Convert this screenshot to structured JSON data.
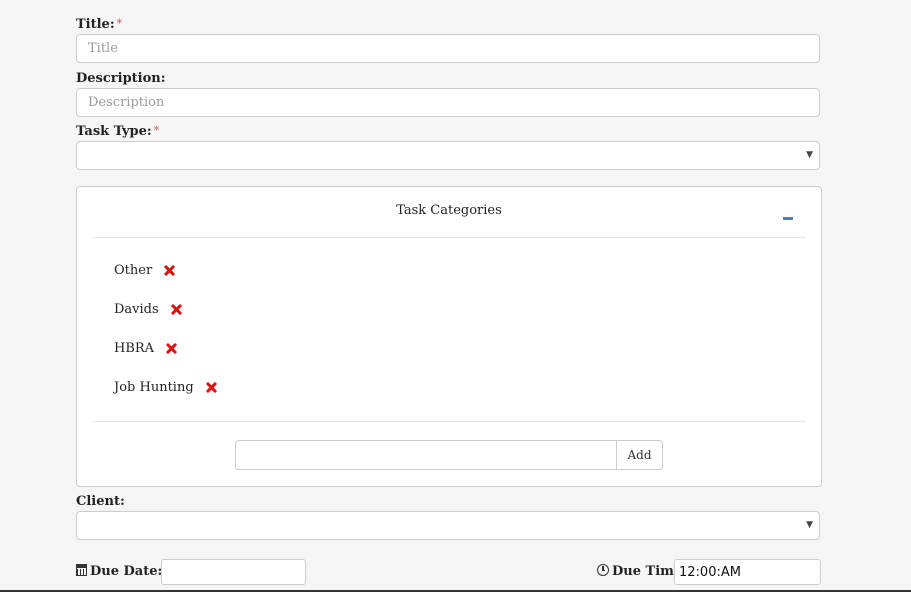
{
  "form": {
    "title_label": "Title:",
    "title_placeholder": "Title",
    "title_value": "",
    "description_label": "Description:",
    "description_placeholder": "Description",
    "description_value": "",
    "task_type_label": "Task Type:",
    "task_type_value": "",
    "client_label": "Client:",
    "client_value": "",
    "due_date_label": "Due Date:",
    "due_date_value": "",
    "due_time_label": "Due Time:",
    "due_time_value": "12:00:AM",
    "required_mark": "*"
  },
  "categories_panel": {
    "title": "Task Categories",
    "collapse_icon": "minus-icon",
    "items": [
      {
        "label": "Other",
        "remove_icon": "remove-x-icon"
      },
      {
        "label": "Davids",
        "remove_icon": "remove-x-icon"
      },
      {
        "label": "HBRA",
        "remove_icon": "remove-x-icon"
      },
      {
        "label": "Job Hunting",
        "remove_icon": "remove-x-icon"
      }
    ],
    "new_category_value": "",
    "add_button_label": "Add"
  },
  "colors": {
    "required": "#e05050",
    "remove": "#dd1111",
    "collapse": "#4a7fc1"
  }
}
